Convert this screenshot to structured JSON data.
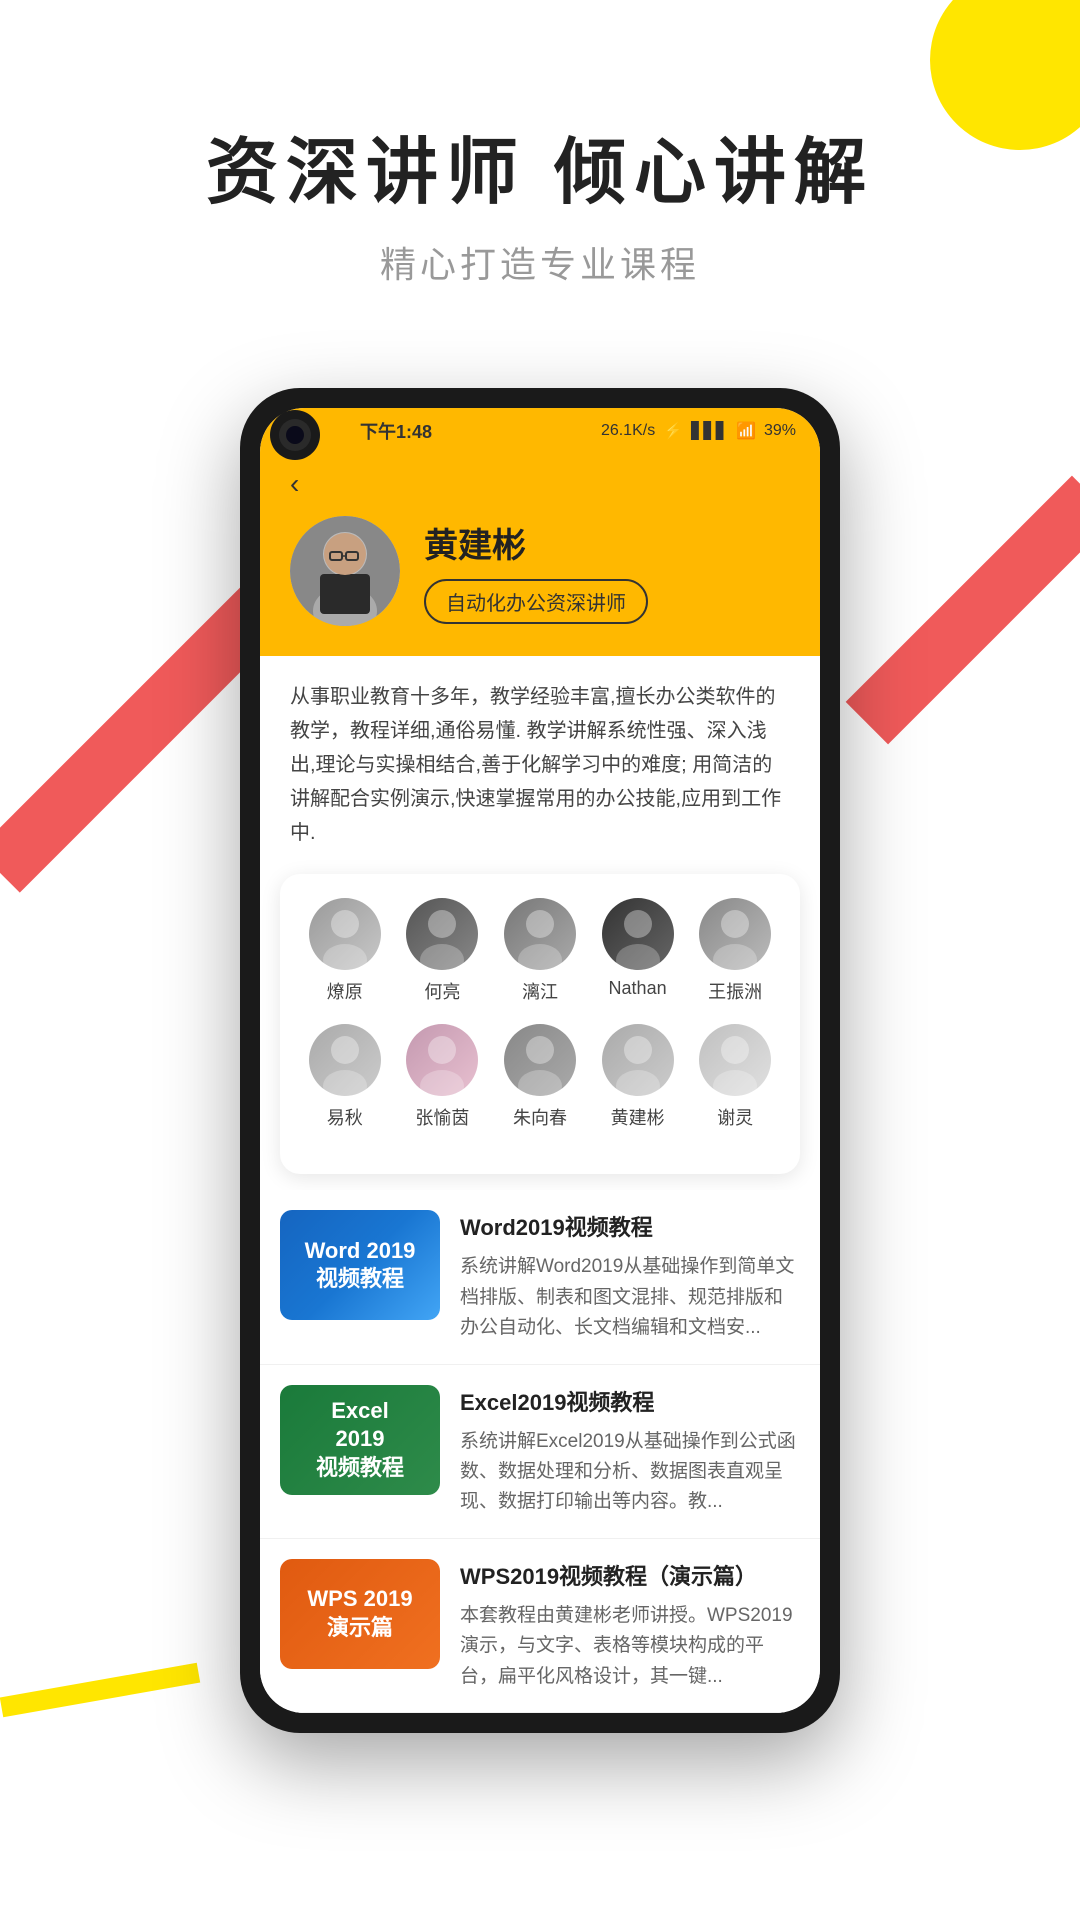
{
  "decorative": {
    "circle_color": "#FFE600",
    "stripe_red_color": "#F05A5A"
  },
  "header": {
    "main_title": "资深讲师  倾心讲解",
    "sub_title": "精心打造专业课程"
  },
  "phone": {
    "status_bar": {
      "time": "下午1:48",
      "network_speed": "26.1K/s",
      "battery": "39%"
    },
    "profile": {
      "back_label": "‹",
      "name": "黄建彬",
      "badge": "自动化办公资深讲师",
      "description": "从事职业教育十多年，教学经验丰富,擅长办公类软件的教学，教程详细,通俗易懂. 教学讲解系统性强、深入浅出,理论与实操相结合,善于化解学习中的难度; 用简洁的讲解配合实例演示,快速掌握常用的办公技能,应用到工作中."
    },
    "instructors": {
      "row1": [
        {
          "name": "燎原",
          "av_class": "av-1"
        },
        {
          "name": "何亮",
          "av_class": "av-2"
        },
        {
          "name": "漓江",
          "av_class": "av-3"
        },
        {
          "name": "Nathan",
          "av_class": "av-4"
        },
        {
          "name": "王振洲",
          "av_class": "av-5"
        }
      ],
      "row2": [
        {
          "name": "易秋",
          "av_class": "av-6"
        },
        {
          "name": "张愉茵",
          "av_class": "av-7"
        },
        {
          "name": "朱向春",
          "av_class": "av-8"
        },
        {
          "name": "黄建彬",
          "av_class": "av-9"
        },
        {
          "name": "谢灵",
          "av_class": "av-10"
        }
      ]
    },
    "courses": [
      {
        "id": "word",
        "thumb_type": "word",
        "thumb_label": "Word 2019\n视频教程",
        "title": "Word2019视频教程",
        "description": "系统讲解Word2019从基础操作到简单文档排版、制表和图文混排、规范排版和办公自动化、长文档编辑和文档安..."
      },
      {
        "id": "excel",
        "thumb_type": "excel",
        "thumb_label": "Excel\n2019\n视频教程",
        "title": "Excel2019视频教程",
        "description": "系统讲解Excel2019从基础操作到公式函数、数据处理和分析、数据图表直观呈现、数据打印输出等内容。教..."
      },
      {
        "id": "wps",
        "thumb_type": "wps",
        "thumb_label": "WPS 2019\n演示篇",
        "title": "WPS2019视频教程（演示篇）",
        "description": "本套教程由黄建彬老师讲授。WPS2019演示，与文字、表格等模块构成的平台，扁平化风格设计，其一键..."
      }
    ]
  }
}
